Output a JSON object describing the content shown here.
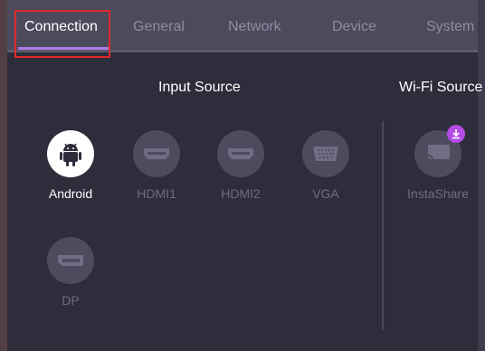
{
  "tabs": [
    {
      "label": "Connection",
      "active": true
    },
    {
      "label": "General",
      "active": false
    },
    {
      "label": "Network",
      "active": false
    },
    {
      "label": "Device",
      "active": false
    },
    {
      "label": "System",
      "active": false
    }
  ],
  "input_source": {
    "title": "Input Source",
    "items": [
      {
        "label": "Android",
        "icon": "android-icon",
        "selected": true
      },
      {
        "label": "HDMI1",
        "icon": "hdmi-icon",
        "selected": false
      },
      {
        "label": "HDMI2",
        "icon": "hdmi-icon",
        "selected": false
      },
      {
        "label": "VGA",
        "icon": "vga-icon",
        "selected": false
      },
      {
        "label": "DP",
        "icon": "displayport-icon",
        "selected": false
      }
    ]
  },
  "wifi_source": {
    "title": "Wi-Fi Source",
    "items": [
      {
        "label": "InstaShare",
        "icon": "cast-icon",
        "badge_icon": "download-icon",
        "selected": false
      }
    ]
  },
  "colors": {
    "accent": "#b07ae8",
    "badge": "#b34be6",
    "highlight": "#e0292c",
    "active_text": "#ffffff",
    "inactive_text": "#6e6d80"
  }
}
